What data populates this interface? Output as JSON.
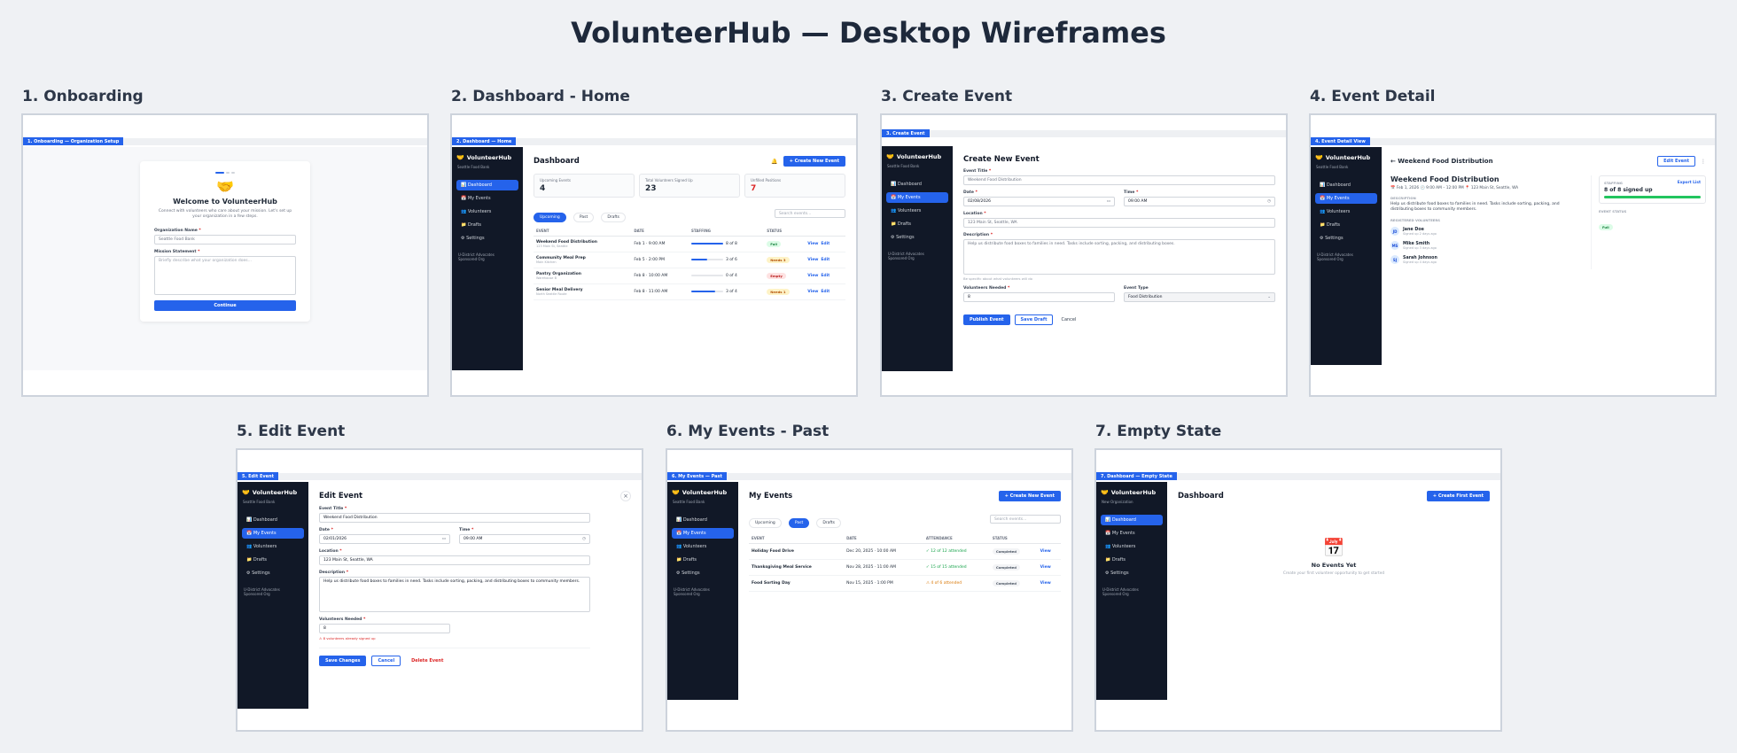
{
  "page_title": "VolunteerHub — Desktop Wireframes",
  "brand": {
    "name": "VolunteerHub",
    "icon": "🤝"
  },
  "nav": {
    "dashboard": "📊 Dashboard",
    "events": "📅 My Events",
    "volunteers": "👥 Volunteers",
    "drafts": "📁 Drafts",
    "settings": "⚙ Settings"
  },
  "footer": {
    "line1": "U-District Advocates",
    "line2": "Sponsored Org"
  },
  "org_name": "Seattle Food Bank",
  "frames": {
    "onboarding": {
      "title": "1. Onboarding",
      "tag": "1. Onboarding — Organization Setup",
      "icon": "🤝",
      "heading": "Welcome to VolunteerHub",
      "intro": "Connect with volunteers who care about your mission. Let's set up your organization in a few steps.",
      "org_label": "Organization Name",
      "org_value": "Seattle Food Bank",
      "mission_label": "Mission Statement",
      "mission_placeholder": "Briefly describe what your organization does...",
      "continue": "Continue"
    },
    "dashboard": {
      "title": "2. Dashboard - Home",
      "tag": "2. Dashboard — Home",
      "heading": "Dashboard",
      "bell": "🔔",
      "create": "+ Create New Event",
      "stats": [
        {
          "label": "Upcoming Events",
          "value": "4"
        },
        {
          "label": "Total Volunteers Signed Up",
          "value": "23"
        },
        {
          "label": "Unfilled Positions",
          "value": "7"
        }
      ],
      "tabs": [
        "Upcoming",
        "Past",
        "Drafts"
      ],
      "search": "Search events...",
      "columns": [
        "EVENT",
        "DATE",
        "STAFFING",
        "STATUS",
        ""
      ],
      "rows": [
        {
          "name": "Weekend Food Distribution",
          "loc": "123 Main St, Seattle",
          "date": "Feb 1 · 9:00 AM",
          "staff": "8 of 8",
          "fill": 1.0,
          "status": "Full",
          "cls": "b-full"
        },
        {
          "name": "Community Meal Prep",
          "loc": "Main Kitchen",
          "date": "Feb 5 · 2:00 PM",
          "staff": "3 of 6",
          "fill": 0.5,
          "status": "Needs 3",
          "cls": "b-need"
        },
        {
          "name": "Pantry Organization",
          "loc": "Warehouse B",
          "date": "Feb 8 · 10:00 AM",
          "staff": "0 of 4",
          "fill": 0.0,
          "status": "Empty",
          "cls": "b-empty"
        },
        {
          "name": "Senior Meal Delivery",
          "loc": "North Seattle Route",
          "date": "Feb 8 · 11:00 AM",
          "staff": "3 of 4",
          "fill": 0.75,
          "status": "Needs 1",
          "cls": "b-need"
        }
      ],
      "view": "View",
      "edit": "Edit"
    },
    "create": {
      "title": "3. Create Event",
      "tag": "3. Create Event",
      "heading": "Create New Event",
      "event_title_label": "Event Title",
      "event_title": "Weekend Food Distribution",
      "date_label": "Date",
      "date": "02/08/2026",
      "time_label": "Time",
      "time": "09:00 AM",
      "location_label": "Location",
      "location": "123 Main St, Seattle, WA",
      "desc_label": "Description",
      "desc": "Help us distribute food boxes to families in need. Tasks include sorting, packing, and distributing boxes.",
      "hint": "Be specific about what volunteers will do",
      "vol_label": "Volunteers Needed",
      "vol": "8",
      "type_label": "Event Type",
      "type": "Food Distribution",
      "publish": "Publish Event",
      "draft": "Save Draft",
      "cancel": "Cancel"
    },
    "detail": {
      "title": "4. Event Detail",
      "tag": "4. Event Detail View",
      "back": "← Weekend Food Distribution",
      "edit": "Edit Event",
      "more": "⋮",
      "name": "Weekend Food Distribution",
      "meta": "📅 Feb 1, 2026    🕘 9:00 AM – 12:00 PM    📍 123 Main St, Seattle, WA",
      "desc_label": "DESCRIPTION",
      "desc": "Help us distribute food boxes to families in need. Tasks include sorting, packing, and distributing boxes to community members.",
      "reg_label": "REGISTERED VOLUNTEERS",
      "volunteers": [
        {
          "initials": "JD",
          "name": "Jane Doe",
          "when": "Signed up 2 days ago"
        },
        {
          "initials": "MS",
          "name": "Mike Smith",
          "when": "Signed up 3 days ago"
        },
        {
          "initials": "SJ",
          "name": "Sarah Johnson",
          "when": "Signed up 4 days ago"
        }
      ],
      "staffing_label": "STAFFING",
      "export": "Export List",
      "staffing": "8 of 8 signed up",
      "fill": 1.0,
      "status_label": "EVENT STATUS",
      "status": "Full"
    },
    "edit": {
      "title": "5. Edit Event",
      "tag": "5. Edit Event",
      "heading": "Edit Event",
      "close": "×",
      "event_title_label": "Event Title",
      "event_title": "Weekend Food Distribution",
      "date_label": "Date",
      "date": "02/01/2026",
      "time_label": "Time",
      "time": "09:00 AM",
      "location_label": "Location",
      "location": "123 Main St, Seattle, WA",
      "desc_label": "Description",
      "desc": "Help us distribute food boxes to families in need. Tasks include sorting, packing, and distributing boxes to community members.",
      "vol_label": "Volunteers Needed",
      "vol": "8",
      "warn": "⚠ 8 volunteers already signed up",
      "save": "Save Changes",
      "cancel": "Cancel",
      "delete": "Delete Event"
    },
    "past": {
      "title": "6. My Events - Past",
      "tag": "6. My Events — Past",
      "heading": "My Events",
      "create": "+ Create New Event",
      "tabs": [
        "Upcoming",
        "Past",
        "Drafts"
      ],
      "search": "Search events...",
      "columns": [
        "EVENT",
        "DATE",
        "ATTENDANCE",
        "STATUS",
        ""
      ],
      "rows": [
        {
          "name": "Holiday Food Drive",
          "date": "Dec 20, 2025 · 10:00 AM",
          "att": "✓ 12 of 12 attended",
          "color": "#16a34a"
        },
        {
          "name": "Thanksgiving Meal Service",
          "date": "Nov 28, 2025 · 11:00 AM",
          "att": "✓ 15 of 15 attended",
          "color": "#16a34a"
        },
        {
          "name": "Food Sorting Day",
          "date": "Nov 15, 2025 · 1:00 PM",
          "att": "⚠ 4 of 6 attended",
          "color": "#d97706"
        }
      ],
      "status": "Completed",
      "view": "View"
    },
    "empty": {
      "title": "7. Empty State",
      "tag": "7. Dashboard — Empty State",
      "org": "New Organization",
      "heading": "Dashboard",
      "create": "+ Create First Event",
      "icon": "📅",
      "empty_title": "No Events Yet",
      "empty_sub": "Create your first volunteer opportunity to get started"
    }
  }
}
